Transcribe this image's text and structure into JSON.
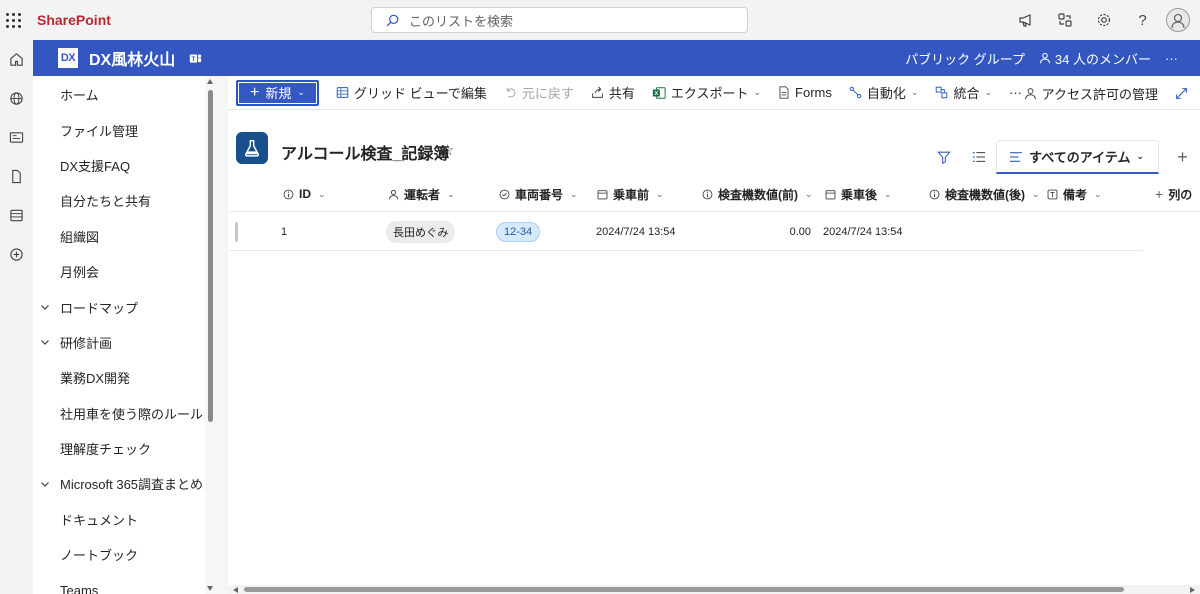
{
  "suite": {
    "brand": "SharePoint",
    "search_placeholder": "このリストを検索",
    "icons": [
      "waffle-icon",
      "megaphone-icon",
      "settings-connections-icon",
      "gear-icon",
      "help-icon",
      "avatar"
    ]
  },
  "site": {
    "logo_text": "DX",
    "title": "DX風林火山",
    "group_type": "パブリック グループ",
    "members": "34 人のメンバー",
    "more": "···",
    "header_color": "#3456c0"
  },
  "nav": {
    "items": [
      {
        "label": "ホーム",
        "group": false
      },
      {
        "label": "ファイル管理",
        "group": false
      },
      {
        "label": "DX支援FAQ",
        "group": false
      },
      {
        "label": "自分たちと共有",
        "group": false
      },
      {
        "label": "組織図",
        "group": false
      },
      {
        "label": "月例会",
        "group": false
      },
      {
        "label": "ロードマップ",
        "group": true
      },
      {
        "label": "研修計画",
        "group": true
      },
      {
        "label": "業務DX開発",
        "group": false
      },
      {
        "label": "社用車を使う際のルール",
        "group": false
      },
      {
        "label": "理解度チェック",
        "group": false
      },
      {
        "label": "Microsoft 365調査まとめ",
        "group": true
      },
      {
        "label": "ドキュメント",
        "group": false
      },
      {
        "label": "ノートブック",
        "group": false
      },
      {
        "label": "Teams",
        "group": false
      }
    ]
  },
  "commands": {
    "new": "新規",
    "grid_edit": "グリッド ビューで編集",
    "undo": "元に戻す",
    "share": "共有",
    "export": "エクスポート",
    "forms": "Forms",
    "automate": "自動化",
    "integrate": "統合",
    "more": "···",
    "access": "アクセス許可の管理"
  },
  "list": {
    "title": "アルコール検査_記録簿",
    "view": "すべてのアイテム",
    "icon_color": "#17508c"
  },
  "columns": [
    {
      "label": "ID"
    },
    {
      "label": "運転者"
    },
    {
      "label": "車両番号"
    },
    {
      "label": "乗車前"
    },
    {
      "label": "検査機数値(前)"
    },
    {
      "label": "乗車後"
    },
    {
      "label": "検査機数値(後)"
    },
    {
      "label": "備考"
    },
    {
      "label": "列の"
    }
  ],
  "rows": [
    {
      "id": "1",
      "driver": "長田めぐみ",
      "vehicle": "12-34",
      "before": "2024/7/24 13:54",
      "value_before": "0.00",
      "after": "2024/7/24 13:54",
      "value_after": "",
      "note": ""
    }
  ]
}
